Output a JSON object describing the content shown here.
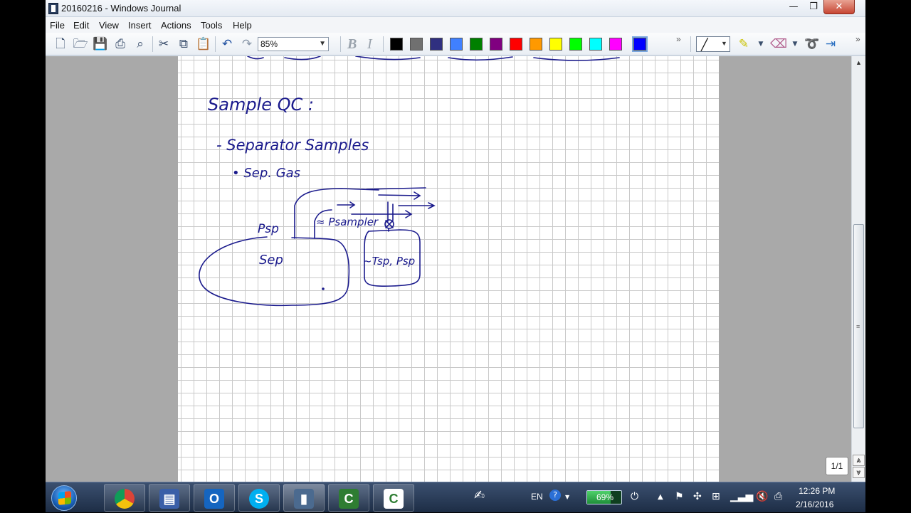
{
  "window": {
    "title": "20160216 - Windows Journal",
    "minimize_glyph": "—",
    "maximize_glyph": "❐",
    "close_glyph": "✕"
  },
  "menu": [
    "File",
    "Edit",
    "View",
    "Insert",
    "Actions",
    "Tools",
    "Help"
  ],
  "toolbar": {
    "zoom": "85%",
    "bold": "B",
    "italic": "I",
    "more": "»",
    "colors": [
      "#000000",
      "#707070",
      "#303080",
      "#4080ff",
      "#008000",
      "#800080",
      "#ff0000",
      "#ff9900",
      "#ffff00",
      "#00ff00",
      "#00ffff",
      "#ff00ff",
      "#0000ff"
    ],
    "icons": [
      "new-page-icon",
      "open-icon",
      "save-icon",
      "print-icon",
      "find-icon",
      "cut-icon",
      "copy-icon",
      "paste-icon",
      "undo-icon",
      "redo-icon"
    ]
  },
  "ink": {
    "title": "Sample QC :",
    "line1": "- Separator  Samples",
    "line2": "• Sep. Gas",
    "label_psp": "Psp",
    "label_psampler": "≈ Psampler",
    "label_sep": "Sep",
    "label_tsp": "~Tsp, Psp",
    "ink_color": "#1a1a8c"
  },
  "scroll": {
    "page_indicator": "1/1",
    "page_up": "⩓",
    "page_down": "⩔"
  },
  "taskbar": {
    "apps": [
      "chrome-app",
      "save-app",
      "outlook-app",
      "skype-app",
      "journal-app",
      "camtasia-recorder-app",
      "camtasia-studio-app"
    ],
    "language": "EN",
    "battery_percent": 69,
    "battery_label": "69%",
    "time": "12:26 PM",
    "date": "2/16/2016"
  }
}
